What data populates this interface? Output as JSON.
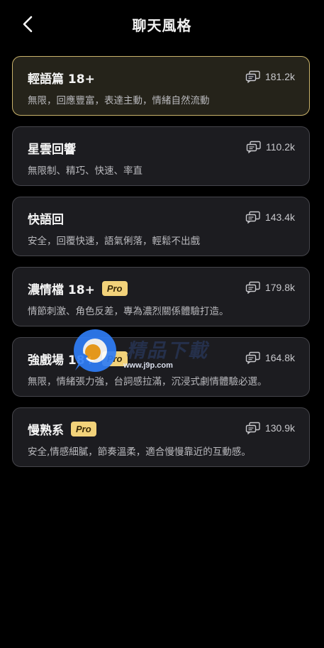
{
  "header": {
    "title": "聊天風格",
    "back_icon": "chevron-left-icon"
  },
  "styles": [
    {
      "title": "輕語篇 18+",
      "pro": false,
      "count": "181.2k",
      "description": "無限，回應豐富，表達主動，情緒自然流動",
      "selected": true
    },
    {
      "title": "星雲回響",
      "pro": false,
      "count": "110.2k",
      "description": "無限制、精巧、快速、率直",
      "selected": false
    },
    {
      "title": "快語回",
      "pro": false,
      "count": "143.4k",
      "description": "安全，回覆快速，語氣俐落，輕鬆不出戲",
      "selected": false
    },
    {
      "title": "濃情檔 18+",
      "pro": true,
      "pro_label": "Pro",
      "count": "179.8k",
      "description": "情節刺激、角色反差，專為濃烈關係體驗打造。",
      "selected": false
    },
    {
      "title": "強戲場 18+",
      "pro": true,
      "pro_label": "Pro",
      "count": "164.8k",
      "description": "無限，情緒張力強，台詞感拉滿，沉浸式劇情體驗必選。",
      "selected": false
    },
    {
      "title": "慢熟系",
      "pro": true,
      "pro_label": "Pro",
      "count": "130.9k",
      "description": "安全,情感細膩，節奏溫柔，適合慢慢靠近的互動感。",
      "selected": false
    }
  ],
  "watermark": {
    "text": "精品下載",
    "url": "www.j9p.com"
  },
  "colors": {
    "background": "#000000",
    "card": "#1c1c20",
    "card_border": "#45454b",
    "selected_border": "#c9b26a",
    "pro_badge": "#f2d27a"
  }
}
